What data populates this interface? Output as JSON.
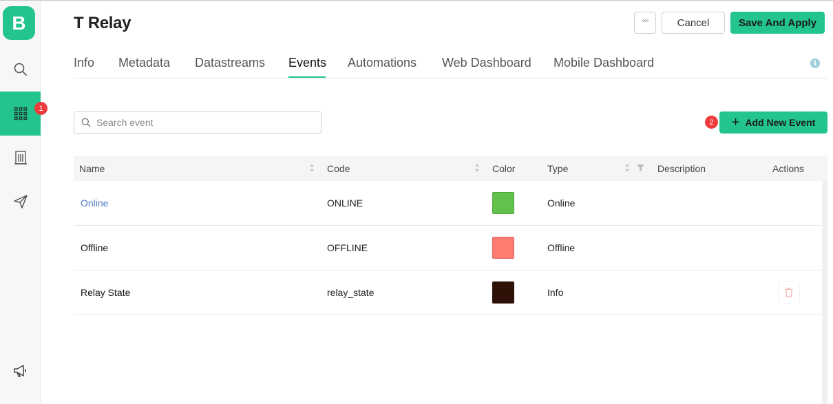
{
  "app": {
    "logo_letter": "B",
    "brand_color": "#23c48e"
  },
  "sidebar": {
    "items": [
      {
        "name": "search",
        "icon": "search-icon",
        "active": false
      },
      {
        "name": "devices",
        "icon": "grid-icon",
        "active": true,
        "badge": "1"
      },
      {
        "name": "organization",
        "icon": "building-icon",
        "active": false
      },
      {
        "name": "send",
        "icon": "paper-plane-icon",
        "active": false
      },
      {
        "name": "announcements",
        "icon": "megaphone-icon",
        "active": false
      }
    ]
  },
  "header": {
    "title": "T Relay",
    "more_label": "°°°",
    "cancel_label": "Cancel",
    "save_label": "Save And Apply"
  },
  "tabs": [
    {
      "label": "Info",
      "active": false
    },
    {
      "label": "Metadata",
      "active": false
    },
    {
      "label": "Datastreams",
      "active": false
    },
    {
      "label": "Events",
      "active": true
    },
    {
      "label": "Automations",
      "active": false
    },
    {
      "label": "Web Dashboard",
      "active": false
    },
    {
      "label": "Mobile Dashboard",
      "active": false
    }
  ],
  "info_icon_label": "i",
  "search": {
    "placeholder": "Search event",
    "value": ""
  },
  "add_button": {
    "label": "Add New Event",
    "badge": "2"
  },
  "table": {
    "columns": {
      "name": "Name",
      "code": "Code",
      "color": "Color",
      "type": "Type",
      "description": "Description",
      "actions": "Actions"
    },
    "rows": [
      {
        "name": "Online",
        "code": "ONLINE",
        "color": "#61c14a",
        "type": "Online",
        "description": ""
      },
      {
        "name": "Offline",
        "code": "OFFLINE",
        "color": "#fe7b72",
        "type": "Offline",
        "description": ""
      },
      {
        "name": "Relay State",
        "code": "relay_state",
        "color": "#2f1207",
        "type": "Info",
        "description": ""
      }
    ]
  }
}
